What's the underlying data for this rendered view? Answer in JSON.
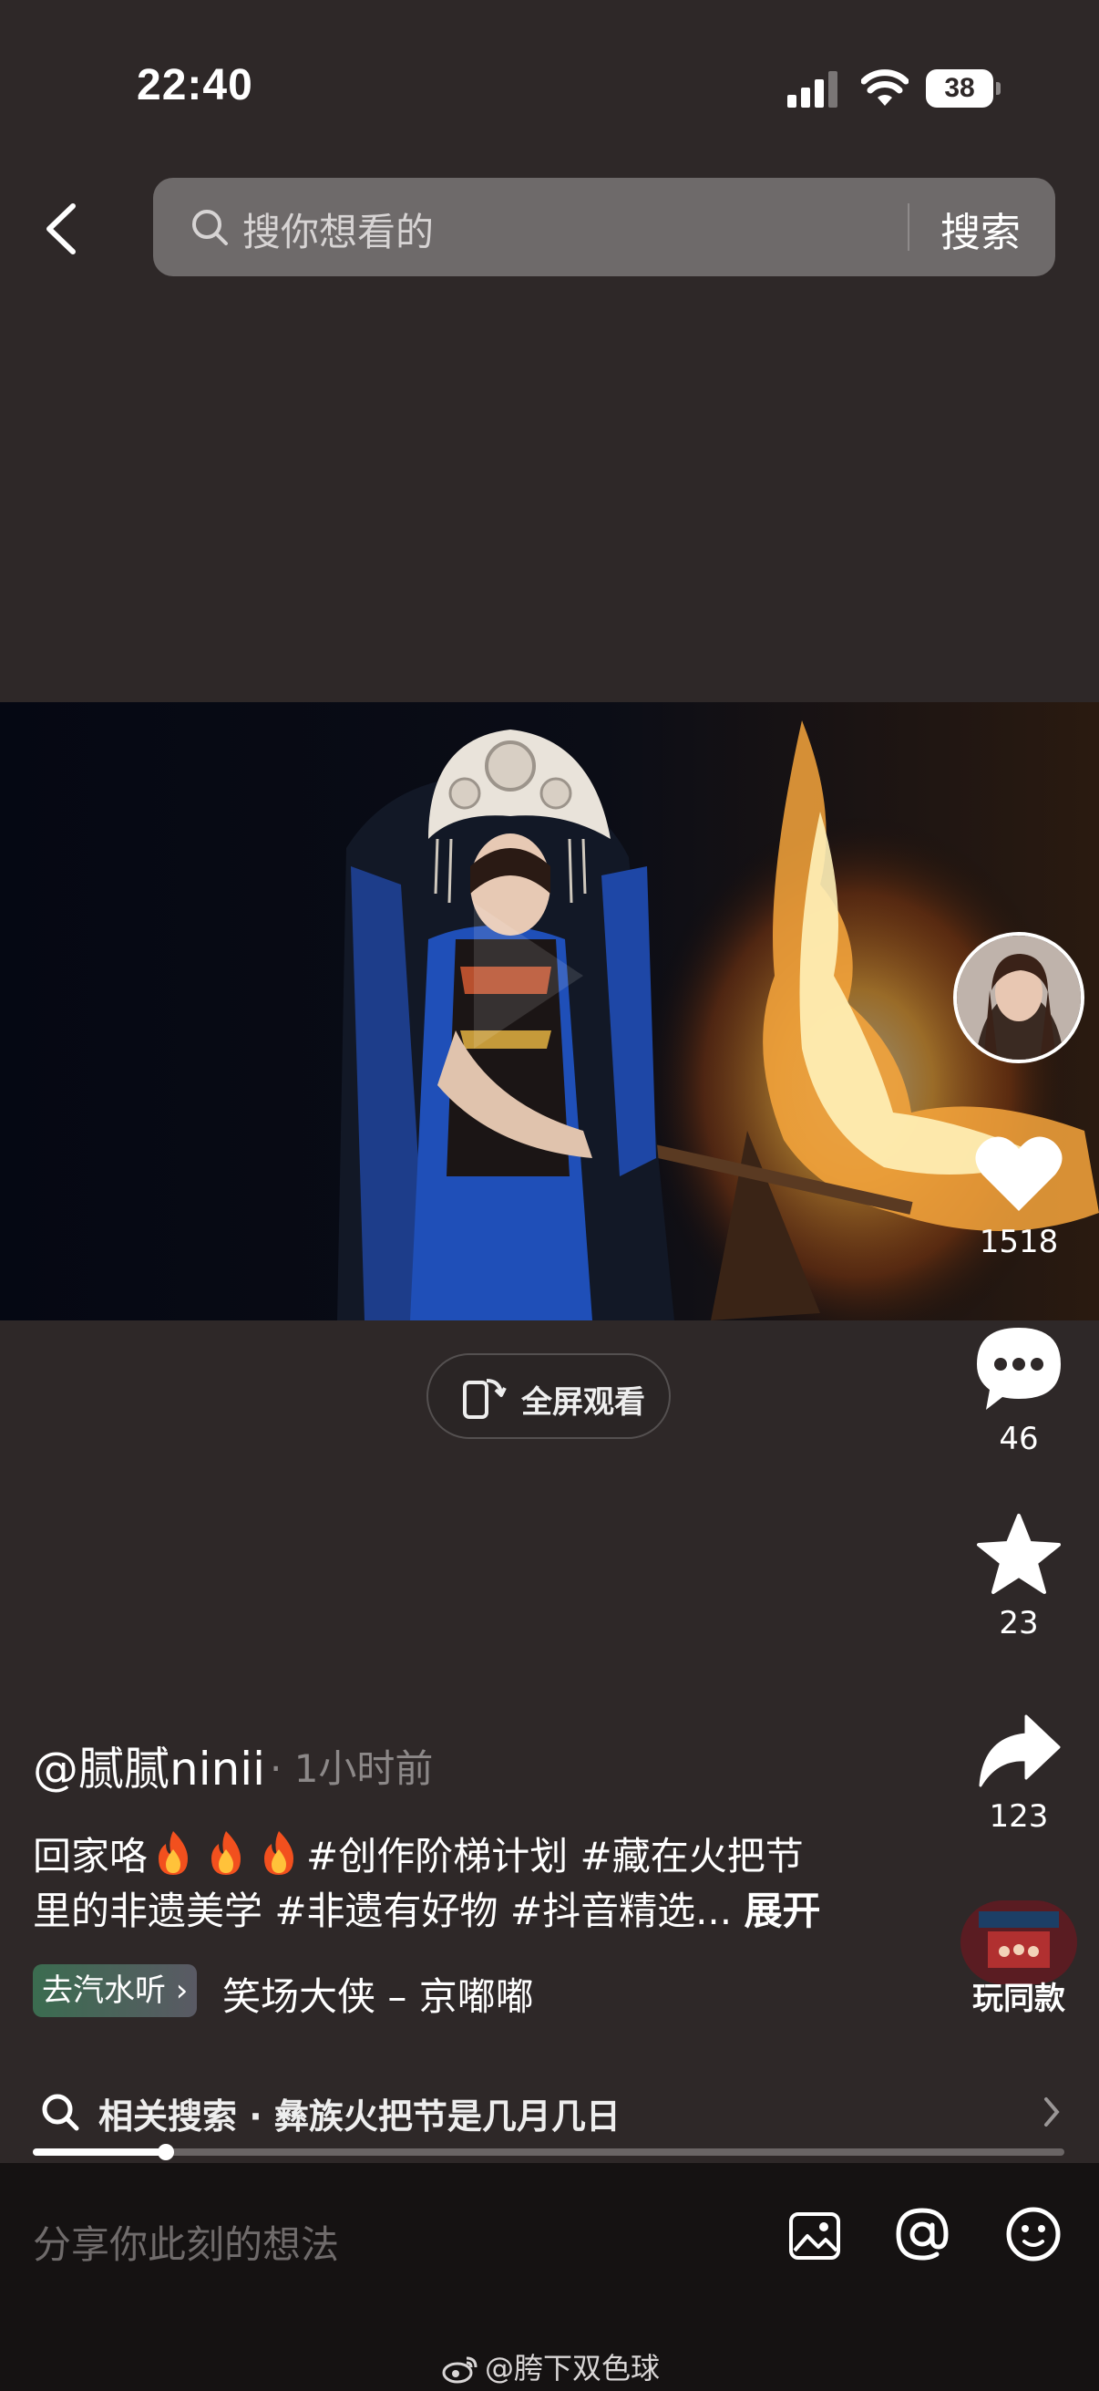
{
  "status_bar": {
    "time": "22:40",
    "battery": "38",
    "icons": [
      "signal-icon",
      "wifi-icon",
      "battery-icon"
    ]
  },
  "search": {
    "placeholder": "搜你想看的",
    "button_label": "搜索",
    "icons": [
      "back-icon",
      "search-icon"
    ]
  },
  "video": {
    "fullscreen_label": "全屏观看"
  },
  "side_actions": {
    "likes": "1518",
    "comments": "46",
    "favorites": "23",
    "shares": "123",
    "template_label": "玩同款"
  },
  "post": {
    "author": "@腻腻ninii",
    "time": "· 1小时前",
    "caption_line1_prefix": "回家咯",
    "caption_line1_suffix": "#创作阶梯计划 #藏在火把节",
    "caption_line2": "里的非遗美学 #非遗有好物 #抖音精选...",
    "expand_label": "展开"
  },
  "music": {
    "tag_label": "去汽水听 ›",
    "title": "笑场大侠 – 京嘟嘟"
  },
  "related_search": {
    "label": "相关搜索 · 彝族火把节是几月几日"
  },
  "progress": {
    "value": 0.129
  },
  "comment_bar": {
    "placeholder": "分享你此刻的想法",
    "icons": [
      "image-icon",
      "at-icon",
      "emoji-icon"
    ]
  },
  "watermark": {
    "text": "@胯下双色球"
  },
  "colors": {
    "background": "#2e2828",
    "search_box": "#6e6a6a",
    "comment_bar": "#151212",
    "music_tag_start": "#3b6c50"
  }
}
